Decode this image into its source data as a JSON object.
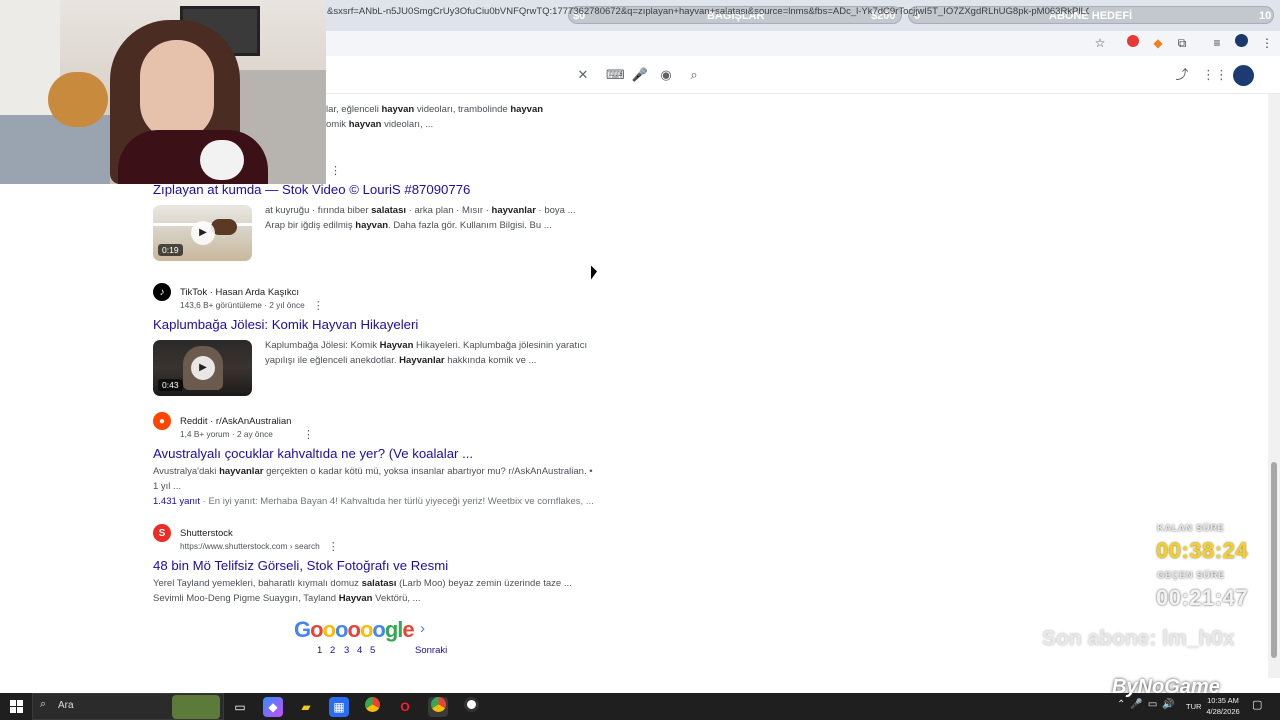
{
  "browser": {
    "address": "&sxsrf=ANbL-n5JU0SmgCrUy3OfuCiu0bVNFQrwTQ:1777362780672&q=zıplayan+hayvan+salatası&source=lnms&fbs=ADc_l-Yk7dC9rTocjjwI5T_IO7ZXgdRLhUG8pk-pM063RkPlLQJoVs..."
  },
  "overlays": {
    "donation_label": "BAĞIŞLAR",
    "donation_min": "$0",
    "donation_max": "$200",
    "sub_goal_label": "ABONE HEDEFİ",
    "sub_goal_min": "0",
    "sub_goal_max": "10",
    "remaining_label": "KALAN SÜRE",
    "remaining_time": "00:38:24",
    "elapsed_label": "GEÇEN SÜRE",
    "elapsed_time": "00:21:47",
    "last_sub": "Son abone: lm_h0x",
    "brand": "ByNoGame"
  },
  "results": {
    "partial": {
      "snippet1_a": "lar, eğlenceli ",
      "snippet1_b": "hayvan",
      "snippet1_c": " videoları, trambolinde ",
      "snippet1_d": "hayvan",
      "snippet2_a": "omik ",
      "snippet2_b": "hayvan",
      "snippet2_c": " videoları, ..."
    },
    "stock": {
      "title": "Zıplayan at kumda — Stok Video © LouriS #87090776",
      "duration": "0:19",
      "line1": [
        "at kuyruğu · fırında biber ",
        "salatası",
        " · arka plan · Mısır · ",
        "hayvanlar",
        " · boya ..."
      ],
      "line2": [
        "Arap bir iğdiş edilmiş ",
        "hayvan",
        ". Daha fazla gör. Kullanım Bilgisi. Bu ..."
      ]
    },
    "tiktok": {
      "source": "TikTok · Hasan Arda Kaşıkcı",
      "meta": "143,6 B+ görüntüleme · 2 yıl önce",
      "title": "Kaplumbağa Jölesi: Komik Hayvan Hikayeleri",
      "duration": "0:43",
      "line1": [
        "Kaplumbağa Jölesi: Komik ",
        "Hayvan",
        " Hikayeleri. Kaplumbağa jölesinin yaratıcı"
      ],
      "line2": [
        "yapılışı ile eğlenceli anekdotlar. ",
        "Hayvanlar",
        " hakkında komik ve ..."
      ]
    },
    "reddit": {
      "source": "Reddit · r/AskAnAustralian",
      "meta": "1,4 B+ yorum · 2 ay önce",
      "title": "Avustralyalı çocuklar kahvaltıda ne yer? (Ve koalalar ...",
      "line1": [
        "Avustralya'daki ",
        "hayvanlar",
        " gerçekten o kadar kötü mü, yoksa insanlar abartıyor mu? r/AskAnAustralian. •"
      ],
      "line2": "1 yıl ...",
      "answers": "1.431 yanıt",
      "best": " · En iyi yanıt: Merhaba Bayan 4! Kahvaltıda her türlü yiyeceği yeriz! Weetbix ve cornflakes, ..."
    },
    "shutterstock": {
      "source": "Shutterstock",
      "url": "https://www.shutterstock.com › search",
      "title": "48 bin Mö Telifsiz Görseli, Stok Fotoğrafı ve Resmi",
      "line1": [
        "Yerel Tayland yemekleri, baharatlı kıymalı domuz ",
        "salatası",
        " (Larb Moo) beyaz zemin üzerinde taze ..."
      ],
      "line2": [
        "Sevimli Moo-Deng Pigme Suaygırı, Tayland ",
        "Hayvan",
        " Vektörü, ..."
      ]
    }
  },
  "pager": {
    "logo": "Goooooogle",
    "pages": [
      "1",
      "2",
      "3",
      "4",
      "5"
    ],
    "next": "Sonraki"
  },
  "taskbar": {
    "search_label": "Ara",
    "lang": "TUR",
    "time": "10:35 AM",
    "date": "4/28/2026"
  },
  "colors": {
    "link": "#1a0dab",
    "timer_yellow": "#f5d02a"
  }
}
